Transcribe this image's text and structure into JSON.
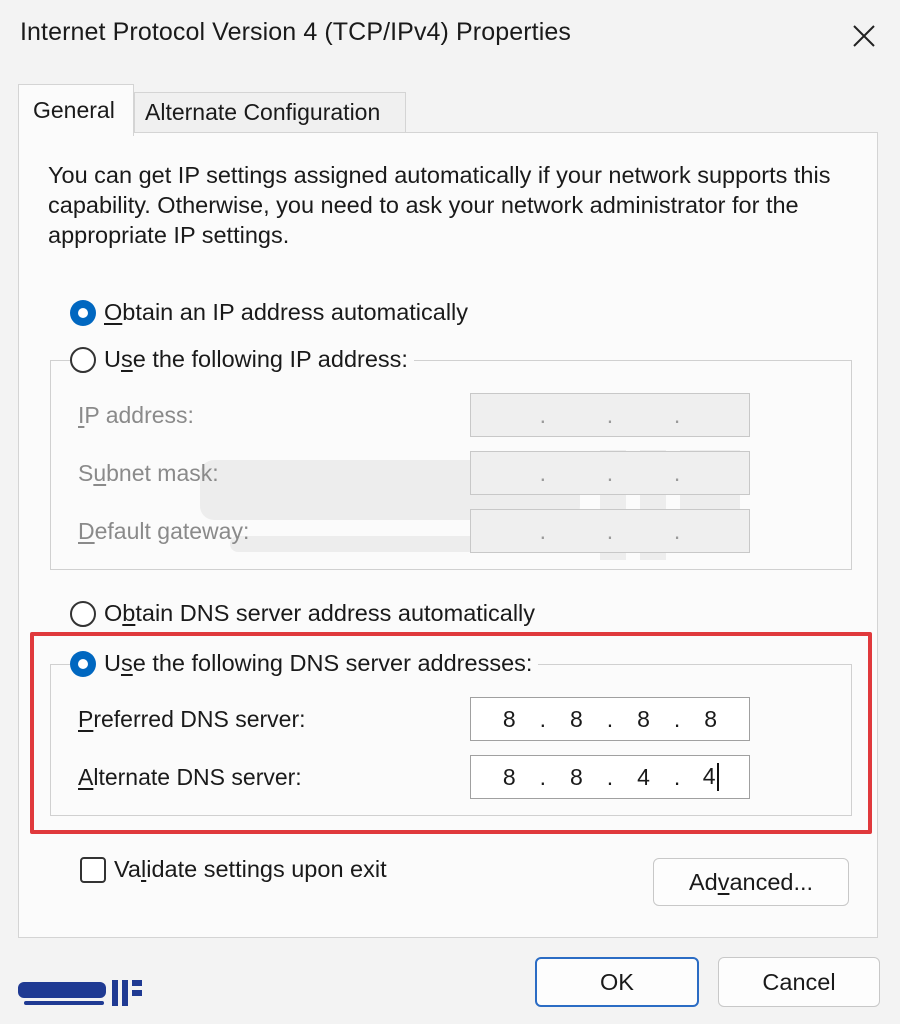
{
  "window": {
    "title": "Internet Protocol Version 4 (TCP/IPv4) Properties",
    "close_icon": "close-icon"
  },
  "tabs": [
    {
      "label": "General",
      "selected": true
    },
    {
      "label": "Alternate Configuration",
      "selected": false
    }
  ],
  "intro_text": "You can get IP settings assigned automatically if your network supports this capability. Otherwise, you need to ask your network administrator for the appropriate IP settings.",
  "ip_mode": {
    "auto": {
      "pre": "",
      "ul": "O",
      "post": "btain an IP address automatically",
      "checked": true
    },
    "manual": {
      "pre": "U",
      "ul": "s",
      "post": "e the following IP address:",
      "checked": false
    }
  },
  "ip_fields": [
    {
      "pre": "",
      "ul": "I",
      "post": "P address:",
      "value": [
        ".",
        ".",
        "."
      ]
    },
    {
      "pre": "S",
      "ul": "u",
      "post": "bnet mask:",
      "value": [
        ".",
        ".",
        "."
      ]
    },
    {
      "pre": "",
      "ul": "D",
      "post": "efault gateway:",
      "value": [
        ".",
        ".",
        "."
      ]
    }
  ],
  "dns_mode": {
    "auto": {
      "pre": "O",
      "ul": "b",
      "post": "tain DNS server address automatically",
      "checked": false
    },
    "manual": {
      "pre": "U",
      "ul": "s",
      "post": "e the following DNS server addresses:",
      "checked": true
    }
  },
  "dns_fields": [
    {
      "pre": "",
      "ul": "P",
      "post": "referred DNS server:",
      "octets": [
        "8",
        "8",
        "8",
        "8"
      ]
    },
    {
      "pre": "",
      "ul": "A",
      "post": "lternate DNS server:",
      "octets": [
        "8",
        "8",
        "4",
        "4"
      ]
    }
  ],
  "validate": {
    "pre": "Va",
    "ul": "l",
    "post": "idate settings upon exit",
    "checked": false
  },
  "buttons": {
    "advanced": {
      "pre": "Ad",
      "ul": "v",
      "post": "anced..."
    },
    "ok": "OK",
    "cancel": "Cancel"
  },
  "colors": {
    "accent": "#0067c0",
    "highlight": "#e0393c"
  }
}
